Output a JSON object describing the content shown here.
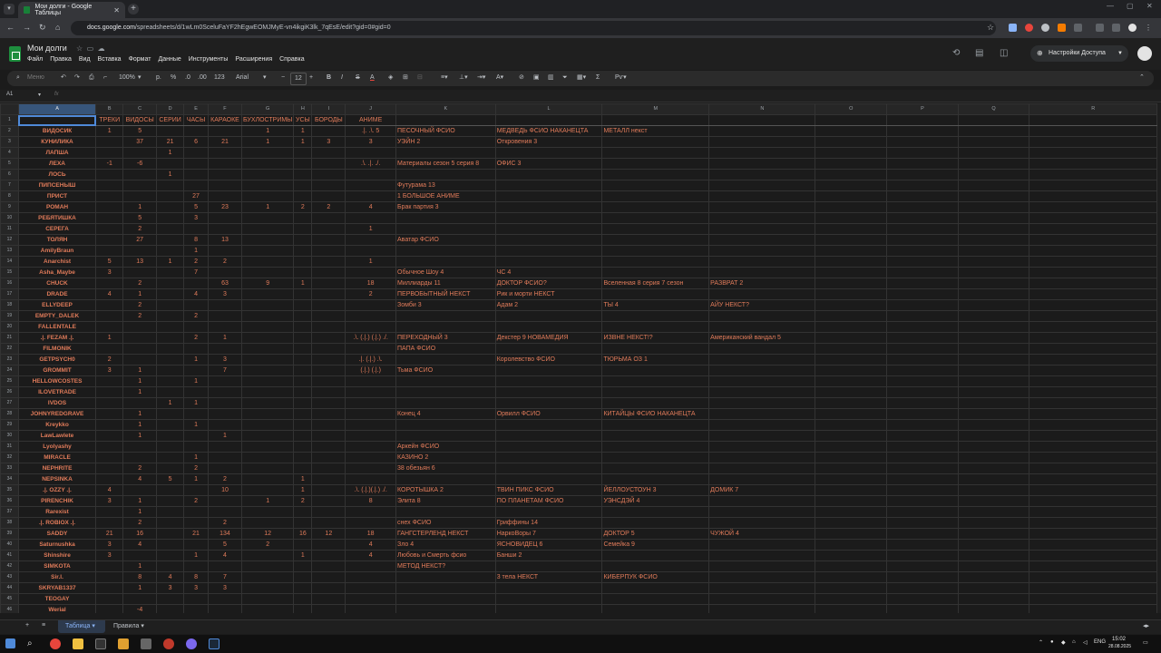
{
  "browser": {
    "tab_title": "Мои долги - Google Таблицы",
    "url_host": "docs.google.com",
    "url_path": "/spreadsheets/d/1wLm0SceluFaYF2hEgwEOMJMyE-vn4ikgiK3lk_7qEsE/edit?gid=0#gid=0"
  },
  "doc": {
    "title": "Мои долги",
    "menus": [
      "Файл",
      "Правка",
      "Вид",
      "Вставка",
      "Формат",
      "Данные",
      "Инструменты",
      "Расширения",
      "Справка"
    ],
    "share_label": "Настройки Доступа"
  },
  "toolbar": {
    "search": "Меню",
    "zoom": "100%",
    "currency": "р.",
    "percent": "%",
    "dec_less": ".0",
    "dec_more": ".00",
    "format_123": "123",
    "font": "Arial",
    "font_size": "12"
  },
  "formula": {
    "cell_ref": "A1",
    "fx": "fx"
  },
  "columns": [
    "A",
    "B",
    "C",
    "D",
    "E",
    "F",
    "G",
    "H",
    "I",
    "J",
    "K",
    "L",
    "M",
    "N",
    "O",
    "P",
    "Q",
    "R"
  ],
  "header_row": [
    "",
    "ТРЕКИ",
    "ВИДОСЫ",
    "СЕРИИ",
    "ЧАСЫ",
    "КАРАОКЕ",
    "БУХЛОСТРИМЫ",
    "УСЫ",
    "БОРОДЫ",
    "АНИМЕ",
    "",
    "",
    "",
    "",
    "",
    "",
    "",
    ""
  ],
  "rows": [
    [
      "ВИДОСИК",
      "1",
      "5",
      "",
      "",
      "",
      "1",
      "1",
      "",
      ".|.  .\\.  5",
      "ПЕСОЧНЫЙ ФСИО",
      "МЕДВЕДЬ ФСИО НАКАНЕЦТА",
      "МЕТАЛЛ некст",
      ""
    ],
    [
      "КУНИЛИКА",
      "",
      "37",
      "21",
      "6",
      "21",
      "1",
      "1",
      "3",
      "3",
      "УЭЙН 2",
      "Откровения 3",
      "",
      ""
    ],
    [
      "ЛАПША",
      "",
      "",
      "1",
      "",
      "",
      "",
      "",
      "",
      "",
      "",
      "",
      "",
      ""
    ],
    [
      "ЛЕХА",
      "-1",
      "-6",
      "",
      "",
      "",
      "",
      "",
      "",
      ".\\.  .|.  ./.",
      "Материалы сезон 5 серия 8",
      "ОФИС 3",
      "",
      ""
    ],
    [
      "ЛОСЬ",
      "",
      "",
      "1",
      "",
      "",
      "",
      "",
      "",
      "",
      "",
      "",
      "",
      ""
    ],
    [
      "ПИПСЕНЫШ",
      "",
      "",
      "",
      "",
      "",
      "",
      "",
      "",
      "",
      "Футурама 13",
      "",
      "",
      ""
    ],
    [
      "ПРИСТ",
      "",
      "",
      "",
      "27",
      "",
      "",
      "",
      "",
      "",
      "1 БОЛЬШОЕ АНИМЕ",
      "",
      "",
      ""
    ],
    [
      "РОМАН",
      "",
      "1",
      "",
      "5",
      "23",
      "1",
      "2",
      "2",
      "4",
      "Брак партия 3",
      "",
      "",
      ""
    ],
    [
      "РЕБЯТИШКА",
      "",
      "5",
      "",
      "3",
      "",
      "",
      "",
      "",
      "",
      "",
      "",
      "",
      ""
    ],
    [
      "СЕРЕГА",
      "",
      "2",
      "",
      "",
      "",
      "",
      "",
      "",
      "1",
      "",
      "",
      "",
      ""
    ],
    [
      "ТОЛЯН",
      "",
      "27",
      "",
      "8",
      "13",
      "",
      "",
      "",
      "",
      "Аватар ФСИО",
      "",
      "",
      ""
    ],
    [
      "AmilyBraun",
      "",
      "",
      "",
      "1",
      "",
      "",
      "",
      "",
      "",
      "",
      "",
      "",
      ""
    ],
    [
      "Anarchist",
      "5",
      "13",
      "1",
      "2",
      "2",
      "",
      "",
      "",
      "1",
      "",
      "",
      "",
      ""
    ],
    [
      "Asha_Maybe",
      "3",
      "",
      "",
      "7",
      "",
      "",
      "",
      "",
      "",
      "Обычное Шоу 4",
      "ЧС 4",
      "",
      ""
    ],
    [
      "CHUCK",
      "",
      "2",
      "",
      "",
      "63",
      "9",
      "1",
      "",
      "18",
      "Миллиарды 11",
      "ДОКТОР ФСИО?",
      "Вселенная 8 серия 7 сезон",
      "РАЗВРАТ 2"
    ],
    [
      "DRADE",
      "4",
      "1",
      "",
      "4",
      "3",
      "",
      "",
      "",
      "2",
      "ПЕРВОБЫТНЫЙ НЕКСТ",
      "Рик и морти НЕКСТ",
      "",
      ""
    ],
    [
      "ELLYDEEP",
      "",
      "2",
      "",
      "",
      "",
      "",
      "",
      "",
      "",
      "Зомби 3",
      "Адам 2",
      "ТЫ 4",
      "АЙУ НЕКСТ?"
    ],
    [
      "EMPTY_DALEK",
      "",
      "2",
      "",
      "2",
      "",
      "",
      "",
      "",
      "",
      "",
      "",
      "",
      ""
    ],
    [
      "FALLENTALE",
      "",
      "",
      "",
      "",
      "",
      "",
      "",
      "",
      "",
      "",
      "",
      "",
      ""
    ],
    [
      ".|. FEZAM .|.",
      "1",
      "",
      "",
      "2",
      "1",
      "",
      "",
      "",
      ".\\. (.|.) (.|.) ./.",
      "ПЕРЕХОДНЫЙ 3",
      "Декстер 9 НОВАМЕДИЯ",
      "ИЗВНЕ НЕКСТ!?",
      "Американский вандал 5"
    ],
    [
      "FILMONIK",
      "",
      "",
      "",
      "",
      "",
      "",
      "",
      "",
      "",
      "ПАПА ФСИО",
      "",
      "",
      ""
    ],
    [
      "GETPSYCH0",
      "2",
      "",
      "",
      "1",
      "3",
      "",
      "",
      "",
      ".|.  (.|.)  .\\.",
      "",
      "Королевство ФСИО",
      "ТЮРЬМА ОЗ 1",
      ""
    ],
    [
      "GROMMIT",
      "3",
      "1",
      "",
      "",
      "7",
      "",
      "",
      "",
      "(.|.) (.|.)",
      "Тьма ФСИО",
      "",
      "",
      ""
    ],
    [
      "HELLOWCOSTES",
      "",
      "1",
      "",
      "1",
      "",
      "",
      "",
      "",
      "",
      "",
      "",
      "",
      ""
    ],
    [
      "ILOVETRADE",
      "",
      "1",
      "",
      "",
      "",
      "",
      "",
      "",
      "",
      "",
      "",
      "",
      ""
    ],
    [
      "IVDOS",
      "",
      "",
      "1",
      "1",
      "",
      "",
      "",
      "",
      "",
      "",
      "",
      "",
      ""
    ],
    [
      "JOHNYREDGRAVE",
      "",
      "1",
      "",
      "",
      "",
      "",
      "",
      "",
      "",
      "Конец 4",
      "Орвилл ФСИО",
      "КИТАЙЦЫ ФСИО НАКАНЕЦТА",
      ""
    ],
    [
      "Kreykko",
      "",
      "1",
      "",
      "1",
      "",
      "",
      "",
      "",
      "",
      "",
      "",
      "",
      ""
    ],
    [
      "LawLawlete",
      "",
      "1",
      "",
      "",
      "1",
      "",
      "",
      "",
      "",
      "",
      "",
      "",
      ""
    ],
    [
      "Lyolyashy",
      "",
      "",
      "",
      "",
      "",
      "",
      "",
      "",
      "",
      "Аркейн ФСИО",
      "",
      "",
      ""
    ],
    [
      "MIRACLE",
      "",
      "",
      "",
      "1",
      "",
      "",
      "",
      "",
      "",
      "КАЗИНО 2",
      "",
      "",
      ""
    ],
    [
      "NEPHRITE",
      "",
      "2",
      "",
      "2",
      "",
      "",
      "",
      "",
      "",
      "38 обезьян 6",
      "",
      "",
      ""
    ],
    [
      "NEPSINKA",
      "",
      "4",
      "5",
      "1",
      "2",
      "",
      "1",
      "",
      "",
      "",
      "",
      "",
      ""
    ],
    [
      ".|. OZZY .|.",
      "4",
      "",
      "",
      "",
      "10",
      "",
      "1",
      "",
      ".\\. (.|.)(.|.) ./.",
      "КОРОТЫШКА 2",
      "ТВИН ПИКС ФСИО",
      "ЙЕЛЛОУСТОУН 3",
      "ДОМИК 7"
    ],
    [
      "PIRENCHIK",
      "3",
      "1",
      "",
      "2",
      "",
      "1",
      "2",
      "",
      "8",
      "Элита 8",
      "ПО ПЛАНЕТАМ ФСИО",
      "УЭНСДЭЙ 4",
      ""
    ],
    [
      "Rarexist",
      "",
      "1",
      "",
      "",
      "",
      "",
      "",
      "",
      "",
      "",
      "",
      "",
      ""
    ],
    [
      ".|. ROBIOX .|.",
      "",
      "2",
      "",
      "",
      "2",
      "",
      "",
      "",
      "",
      "снех ФСИО",
      "Гриффины 14",
      "",
      ""
    ],
    [
      "SADDY",
      "21",
      "16",
      "",
      "21",
      "134",
      "12",
      "16",
      "12",
      "18",
      "ГАНГСТЕРЛЕНД НЕКСТ",
      "НаркоВоры 7",
      "ДОКТОР 5",
      "ЧУЖОЙ 4"
    ],
    [
      "Saturnushka",
      "3",
      "4",
      "",
      "",
      "5",
      "2",
      "",
      "",
      "4",
      "Зло 4",
      "ЯСНОВИДЕЦ 6",
      "Семейка 9",
      ""
    ],
    [
      "Shinshire",
      "3",
      "",
      "",
      "1",
      "4",
      "",
      "1",
      "",
      "4",
      "Любовь и Смерть фсио",
      "Банши 2",
      "",
      ""
    ],
    [
      "SIMKOTA",
      "",
      "1",
      "",
      "",
      "",
      "",
      "",
      "",
      "",
      "МЕТОД НЕКСТ?",
      "",
      "",
      ""
    ],
    [
      "Sir.l.",
      "",
      "8",
      "4",
      "8",
      "7",
      "",
      "",
      "",
      "",
      "",
      "3 тела НЕКСТ",
      "КИБЕРПУК ФСИО",
      ""
    ],
    [
      "SKRYAB1337",
      "",
      "1",
      "3",
      "3",
      "3",
      "",
      "",
      "",
      "",
      "",
      "",
      "",
      ""
    ],
    [
      "TEOGAY",
      "",
      "",
      "",
      "",
      "",
      "",
      "",
      "",
      "",
      "",
      "",
      "",
      ""
    ],
    [
      "Werial",
      "",
      "-4",
      "",
      "",
      "",
      "",
      "",
      "",
      "",
      "",
      "",
      "",
      ""
    ]
  ],
  "sheets": {
    "add": "+",
    "list": "≡",
    "active": "Таблица",
    "second": "Правила"
  },
  "taskbar": {
    "lang": "ENG",
    "time": "15:02",
    "date": "28.08.2025"
  },
  "colors": {
    "accent_text": "#e07b5a",
    "selection": "#4f8ad9",
    "sheets_green": "#1e8e3e"
  }
}
